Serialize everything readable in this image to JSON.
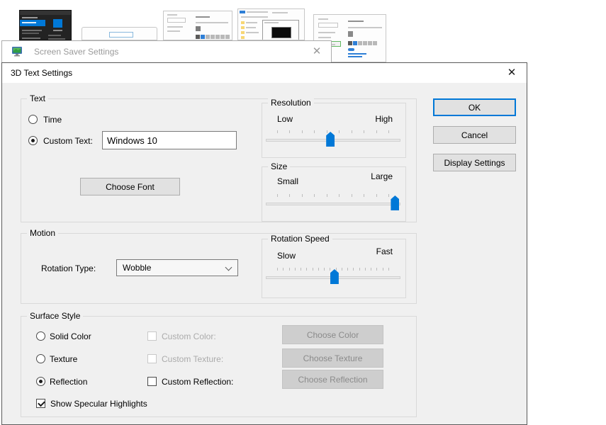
{
  "screensaver_window": {
    "title": "Screen Saver Settings",
    "close": "✕"
  },
  "dialog": {
    "title": "3D Text Settings",
    "close": "✕",
    "accent_color": "#0078d7",
    "groups": {
      "text": {
        "label": "Text",
        "time_label": "Time",
        "time_selected": false,
        "custom_text_label": "Custom Text:",
        "custom_text_selected": true,
        "custom_text_value": "Windows 10",
        "choose_font_label": "Choose Font"
      },
      "resolution": {
        "label": "Resolution",
        "low": "Low",
        "high": "High",
        "percent": 48,
        "ticks": 10
      },
      "size": {
        "label": "Size",
        "small": "Small",
        "large": "Large",
        "percent": 96,
        "ticks": 10
      },
      "motion": {
        "label": "Motion",
        "rotation_type_label": "Rotation Type:",
        "rotation_type_value": "Wobble"
      },
      "rotation_speed": {
        "label": "Rotation Speed",
        "slow": "Slow",
        "fast": "Fast",
        "percent": 51,
        "ticks": 20
      },
      "surface": {
        "label": "Surface Style",
        "solid_color_label": "Solid Color",
        "texture_label": "Texture",
        "reflection_label": "Reflection",
        "selected_style": "Reflection",
        "show_specular_label": "Show Specular Highlights",
        "show_specular_checked": true,
        "custom_color_label": "Custom Color:",
        "custom_color_enabled": false,
        "custom_texture_label": "Custom Texture:",
        "custom_texture_enabled": false,
        "custom_reflection_label": "Custom Reflection:",
        "custom_reflection_enabled": true,
        "custom_reflection_checked": false,
        "choose_color_label": "Choose Color",
        "choose_texture_label": "Choose Texture",
        "choose_reflection_label": "Choose Reflection"
      }
    },
    "buttons": {
      "ok": "OK",
      "cancel": "Cancel",
      "display_settings": "Display Settings"
    }
  }
}
